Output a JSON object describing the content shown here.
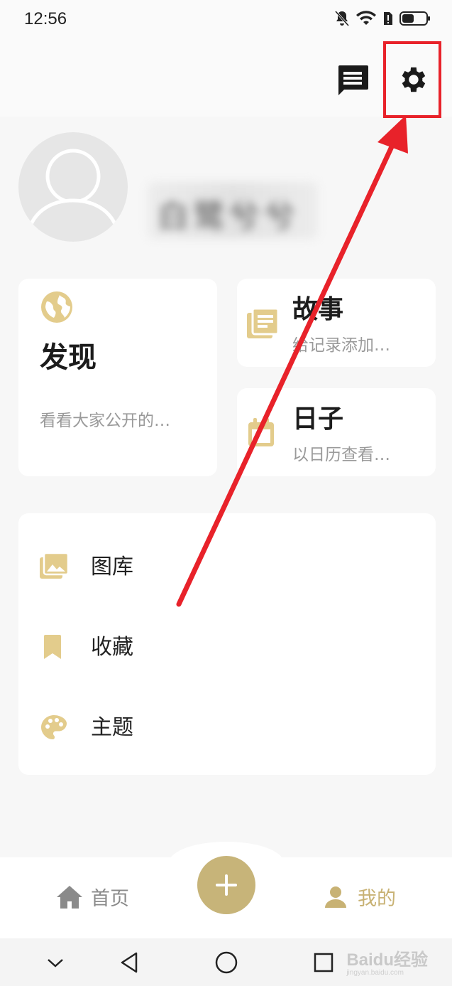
{
  "status_bar": {
    "time": "12:56"
  },
  "profile": {
    "name": "白鹭兮兮"
  },
  "cards": {
    "discover": {
      "title": "发现",
      "desc": "看看大家公开的…"
    },
    "story": {
      "title": "故事",
      "desc": "给记录添加…"
    },
    "days": {
      "title": "日子",
      "desc": "以日历查看…"
    }
  },
  "menu": [
    {
      "label": "图库",
      "icon": "gallery-icon"
    },
    {
      "label": "收藏",
      "icon": "bookmark-icon"
    },
    {
      "label": "主题",
      "icon": "palette-icon"
    }
  ],
  "bottom_nav": {
    "home": "首页",
    "mine": "我的"
  },
  "watermark": {
    "text": "Baidu经验",
    "sub": "jingyan.baidu.com"
  },
  "colors": {
    "accent": "#c7b479",
    "icon_gold": "#e3cc8c",
    "annotation_red": "#e8222a"
  }
}
